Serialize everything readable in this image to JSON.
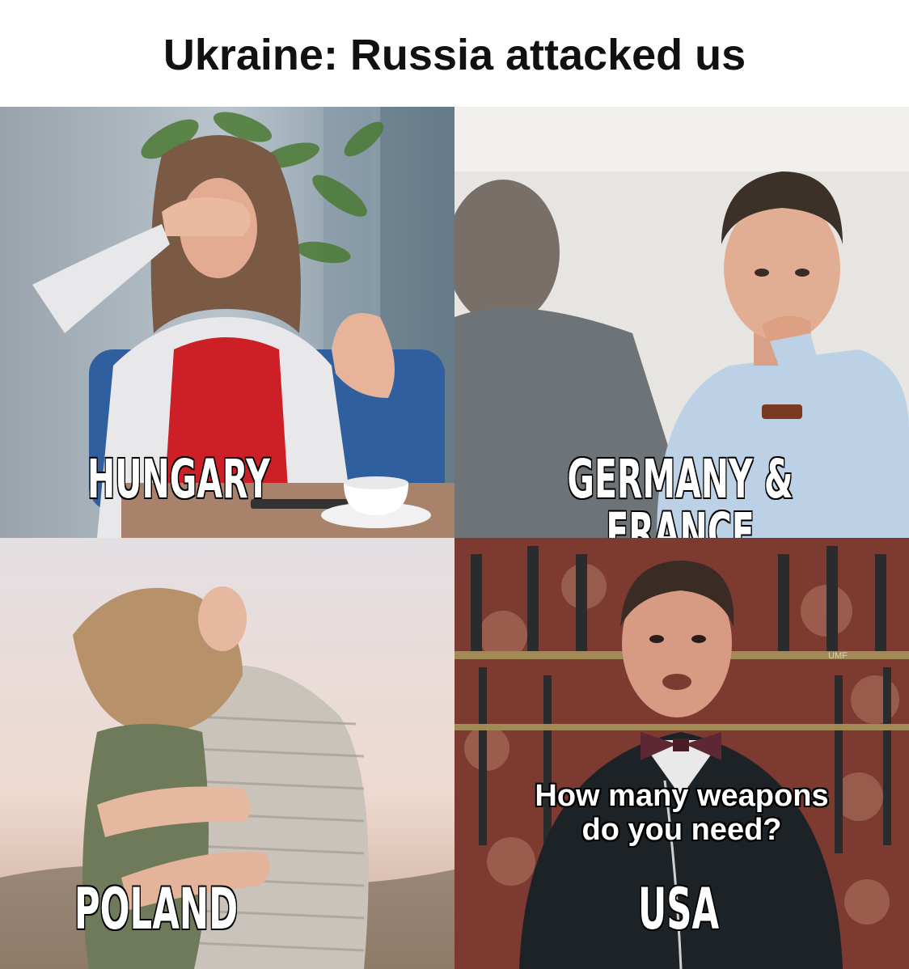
{
  "header": {
    "title": "Ukraine: Russia attacked us"
  },
  "panels": [
    {
      "id": "hungary",
      "caption": "HUNGARY",
      "illustration_icon": "woman-covering-eyes-icon"
    },
    {
      "id": "germany_france",
      "caption": "GERMANY & FRANCE",
      "illustration_icon": "man-thinking-icon"
    },
    {
      "id": "poland",
      "caption": "POLAND",
      "illustration_icon": "hugging-people-icon"
    },
    {
      "id": "usa",
      "caption": "USA",
      "quote": "How many weapons do you need?",
      "watermark": "UMF",
      "illustration_icon": "arms-dealer-icon"
    }
  ],
  "colors": {
    "caption_fill": "#ffffff",
    "caption_stroke": "#000000"
  }
}
